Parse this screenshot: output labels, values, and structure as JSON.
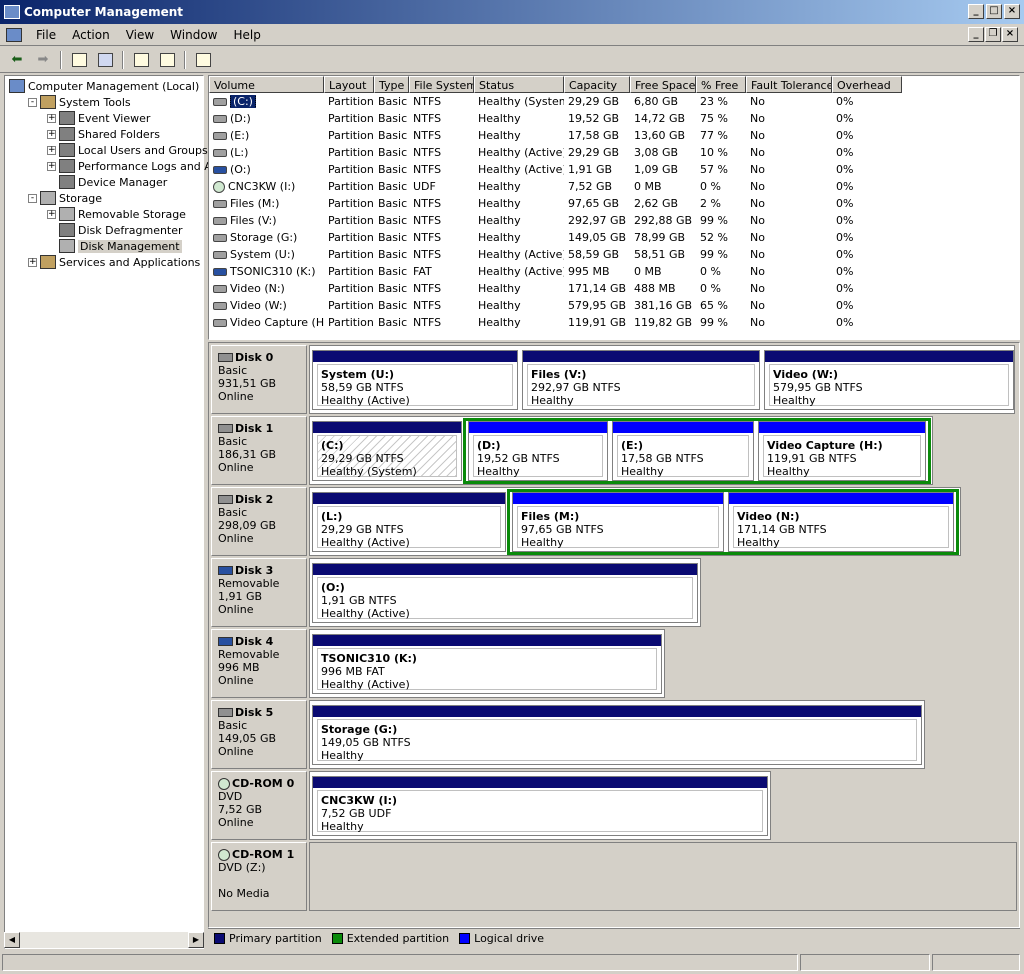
{
  "window": {
    "title": "Computer Management"
  },
  "menu": [
    "File",
    "Action",
    "View",
    "Window",
    "Help"
  ],
  "tree": [
    {
      "label": "Computer Management (Local)",
      "level": 0,
      "exp": "",
      "icon": "comp",
      "name": "tree-computer-management"
    },
    {
      "label": "System Tools",
      "level": 1,
      "exp": "−",
      "icon": "tool",
      "name": "tree-system-tools"
    },
    {
      "label": "Event Viewer",
      "level": 2,
      "exp": "+",
      "icon": "gen",
      "name": "tree-event-viewer"
    },
    {
      "label": "Shared Folders",
      "level": 2,
      "exp": "+",
      "icon": "gen",
      "name": "tree-shared-folders"
    },
    {
      "label": "Local Users and Groups",
      "level": 2,
      "exp": "+",
      "icon": "gen",
      "name": "tree-local-users"
    },
    {
      "label": "Performance Logs and Alerts",
      "level": 2,
      "exp": "+",
      "icon": "gen",
      "name": "tree-performance-logs"
    },
    {
      "label": "Device Manager",
      "level": 2,
      "exp": "",
      "icon": "gen",
      "name": "tree-device-manager"
    },
    {
      "label": "Storage",
      "level": 1,
      "exp": "−",
      "icon": "disk",
      "name": "tree-storage"
    },
    {
      "label": "Removable Storage",
      "level": 2,
      "exp": "+",
      "icon": "disk",
      "name": "tree-removable-storage"
    },
    {
      "label": "Disk Defragmenter",
      "level": 2,
      "exp": "",
      "icon": "gen",
      "name": "tree-disk-defragmenter"
    },
    {
      "label": "Disk Management",
      "level": 2,
      "exp": "",
      "icon": "disk",
      "name": "tree-disk-management",
      "selected": true
    },
    {
      "label": "Services and Applications",
      "level": 1,
      "exp": "+",
      "icon": "tool",
      "name": "tree-services-apps"
    }
  ],
  "columns": [
    "Volume",
    "Layout",
    "Type",
    "File System",
    "Status",
    "Capacity",
    "Free Space",
    "% Free",
    "Fault Tolerance",
    "Overhead"
  ],
  "volumes": [
    {
      "volume": "(C:)",
      "layout": "Partition",
      "type": "Basic",
      "fs": "NTFS",
      "status": "Healthy (System)",
      "capacity": "29,29 GB",
      "free": "6,80 GB",
      "pct": "23 %",
      "fault": "No",
      "overhead": "0%",
      "icon": "hd",
      "selected": true
    },
    {
      "volume": "(D:)",
      "layout": "Partition",
      "type": "Basic",
      "fs": "NTFS",
      "status": "Healthy",
      "capacity": "19,52 GB",
      "free": "14,72 GB",
      "pct": "75 %",
      "fault": "No",
      "overhead": "0%",
      "icon": "hd"
    },
    {
      "volume": "(E:)",
      "layout": "Partition",
      "type": "Basic",
      "fs": "NTFS",
      "status": "Healthy",
      "capacity": "17,58 GB",
      "free": "13,60 GB",
      "pct": "77 %",
      "fault": "No",
      "overhead": "0%",
      "icon": "hd"
    },
    {
      "volume": "(L:)",
      "layout": "Partition",
      "type": "Basic",
      "fs": "NTFS",
      "status": "Healthy (Active)",
      "capacity": "29,29 GB",
      "free": "3,08 GB",
      "pct": "10 %",
      "fault": "No",
      "overhead": "0%",
      "icon": "hd"
    },
    {
      "volume": "(O:)",
      "layout": "Partition",
      "type": "Basic",
      "fs": "NTFS",
      "status": "Healthy (Active)",
      "capacity": "1,91 GB",
      "free": "1,09 GB",
      "pct": "57 %",
      "fault": "No",
      "overhead": "0%",
      "icon": "rm"
    },
    {
      "volume": "CNC3KW (I:)",
      "layout": "Partition",
      "type": "Basic",
      "fs": "UDF",
      "status": "Healthy",
      "capacity": "7,52 GB",
      "free": "0 MB",
      "pct": "0 %",
      "fault": "No",
      "overhead": "0%",
      "icon": "cd"
    },
    {
      "volume": "Files (M:)",
      "layout": "Partition",
      "type": "Basic",
      "fs": "NTFS",
      "status": "Healthy",
      "capacity": "97,65 GB",
      "free": "2,62 GB",
      "pct": "2 %",
      "fault": "No",
      "overhead": "0%",
      "icon": "hd"
    },
    {
      "volume": "Files (V:)",
      "layout": "Partition",
      "type": "Basic",
      "fs": "NTFS",
      "status": "Healthy",
      "capacity": "292,97 GB",
      "free": "292,88 GB",
      "pct": "99 %",
      "fault": "No",
      "overhead": "0%",
      "icon": "hd"
    },
    {
      "volume": "Storage (G:)",
      "layout": "Partition",
      "type": "Basic",
      "fs": "NTFS",
      "status": "Healthy",
      "capacity": "149,05 GB",
      "free": "78,99 GB",
      "pct": "52 %",
      "fault": "No",
      "overhead": "0%",
      "icon": "hd"
    },
    {
      "volume": "System (U:)",
      "layout": "Partition",
      "type": "Basic",
      "fs": "NTFS",
      "status": "Healthy (Active)",
      "capacity": "58,59 GB",
      "free": "58,51 GB",
      "pct": "99 %",
      "fault": "No",
      "overhead": "0%",
      "icon": "hd"
    },
    {
      "volume": "TSONIC310 (K:)",
      "layout": "Partition",
      "type": "Basic",
      "fs": "FAT",
      "status": "Healthy (Active)",
      "capacity": "995 MB",
      "free": "0 MB",
      "pct": "0 %",
      "fault": "No",
      "overhead": "0%",
      "icon": "rm"
    },
    {
      "volume": "Video (N:)",
      "layout": "Partition",
      "type": "Basic",
      "fs": "NTFS",
      "status": "Healthy",
      "capacity": "171,14 GB",
      "free": "488 MB",
      "pct": "0 %",
      "fault": "No",
      "overhead": "0%",
      "icon": "hd"
    },
    {
      "volume": "Video (W:)",
      "layout": "Partition",
      "type": "Basic",
      "fs": "NTFS",
      "status": "Healthy",
      "capacity": "579,95 GB",
      "free": "381,16 GB",
      "pct": "65 %",
      "fault": "No",
      "overhead": "0%",
      "icon": "hd"
    },
    {
      "volume": "Video Capture (H:)",
      "layout": "Partition",
      "type": "Basic",
      "fs": "NTFS",
      "status": "Healthy",
      "capacity": "119,91 GB",
      "free": "119,82 GB",
      "pct": "99 %",
      "fault": "No",
      "overhead": "0%",
      "icon": "hd"
    }
  ],
  "disks": [
    {
      "name": "Disk 0",
      "type": "Basic",
      "size": "931,51 GB",
      "state": "Online",
      "icon": "hd",
      "partitions": [
        {
          "name": "System  (U:)",
          "detail": "58,59 GB NTFS",
          "status": "Healthy (Active)"
        },
        {
          "name": "Files  (V:)",
          "detail": "292,97 GB NTFS",
          "status": "Healthy"
        },
        {
          "name": "Video  (W:)",
          "detail": "579,95 GB NTFS",
          "status": "Healthy"
        }
      ]
    },
    {
      "name": "Disk 1",
      "type": "Basic",
      "size": "186,31 GB",
      "state": "Online",
      "icon": "hd",
      "partitions": [
        {
          "name": "(C:)",
          "detail": "29,29 GB NTFS",
          "status": "Healthy (System)",
          "hatched": true
        },
        {
          "name": "(D:)",
          "detail": "19,52 GB NTFS",
          "status": "Healthy",
          "logical": true
        },
        {
          "name": "(E:)",
          "detail": "17,58 GB NTFS",
          "status": "Healthy",
          "logical": true
        },
        {
          "name": "Video Capture  (H:)",
          "detail": "119,91 GB NTFS",
          "status": "Healthy",
          "logical": true
        }
      ]
    },
    {
      "name": "Disk 2",
      "type": "Basic",
      "size": "298,09 GB",
      "state": "Online",
      "icon": "hd",
      "partitions": [
        {
          "name": "(L:)",
          "detail": "29,29 GB NTFS",
          "status": "Healthy (Active)"
        },
        {
          "name": "Files  (M:)",
          "detail": "97,65 GB NTFS",
          "status": "Healthy",
          "logical": true
        },
        {
          "name": "Video  (N:)",
          "detail": "171,14 GB NTFS",
          "status": "Healthy",
          "logical": true
        }
      ]
    },
    {
      "name": "Disk 3",
      "type": "Removable",
      "size": "1,91 GB",
      "state": "Online",
      "icon": "rm",
      "partitions": [
        {
          "name": "(O:)",
          "detail": "1,91 GB NTFS",
          "status": "Healthy (Active)"
        }
      ]
    },
    {
      "name": "Disk 4",
      "type": "Removable",
      "size": "996 MB",
      "state": "Online",
      "icon": "rm",
      "partitions": [
        {
          "name": "TSONIC310  (K:)",
          "detail": "996 MB FAT",
          "status": "Healthy (Active)"
        }
      ]
    },
    {
      "name": "Disk 5",
      "type": "Basic",
      "size": "149,05 GB",
      "state": "Online",
      "icon": "hd",
      "partitions": [
        {
          "name": "Storage  (G:)",
          "detail": "149,05 GB NTFS",
          "status": "Healthy"
        }
      ]
    },
    {
      "name": "CD-ROM 0",
      "type": "DVD",
      "size": "7,52 GB",
      "state": "Online",
      "icon": "cd",
      "partitions": [
        {
          "name": "CNC3KW  (I:)",
          "detail": "7,52 GB UDF",
          "status": "Healthy"
        }
      ]
    },
    {
      "name": "CD-ROM 1",
      "type": "DVD (Z:)",
      "size": "",
      "state": "No Media",
      "icon": "cd",
      "partitions": []
    }
  ],
  "legend": [
    {
      "label": "Primary partition",
      "color": "#0a0a72"
    },
    {
      "label": "Extended partition",
      "color": "#0a8a0a"
    },
    {
      "label": "Logical drive",
      "color": "#0000ff"
    }
  ]
}
